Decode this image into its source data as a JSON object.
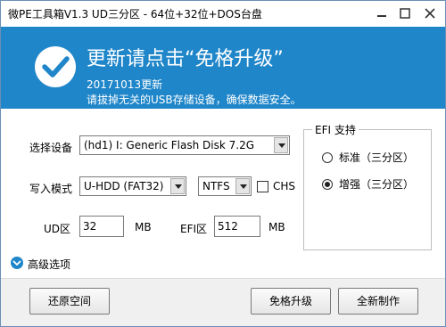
{
  "window": {
    "title": "微PE工具箱V1.3 UD三分区 - 64位+32位+DOS台盘"
  },
  "banner": {
    "headline": "更新请点击“免格升级”",
    "date_line": "20171013更新",
    "note": "请拔掉无关的USB存储设备，确保数据安全。",
    "color": "#1f86c9"
  },
  "form": {
    "device_label": "选择设备",
    "device_value": "(hd1) I: Generic Flash Disk 7.2G",
    "mode_label": "写入模式",
    "mode_value": "U-HDD (FAT32)",
    "fs_value": "NTFS",
    "chs_label": "CHS",
    "chs_checked": false,
    "ud_label": "UD区",
    "ud_value": "32",
    "ud_unit": "MB",
    "efi_size_label": "EFI区",
    "efi_size_value": "512",
    "efi_unit": "MB",
    "advanced_label": "高级选项"
  },
  "efi_group": {
    "legend": "EFI 支持",
    "options": [
      {
        "label": "标准（三分区）",
        "checked": false
      },
      {
        "label": "增强（三分区）",
        "checked": true
      }
    ]
  },
  "footer": {
    "restore_label": "还原空间",
    "upgrade_label": "免格升级",
    "new_label": "全新制作"
  },
  "icons": {
    "check": "check-circle-icon",
    "minimize": "minimize-icon",
    "maximize": "maximize-icon",
    "close": "close-icon",
    "dropdown": "chevron-down-icon",
    "advanced": "chevron-down-circle-icon"
  }
}
